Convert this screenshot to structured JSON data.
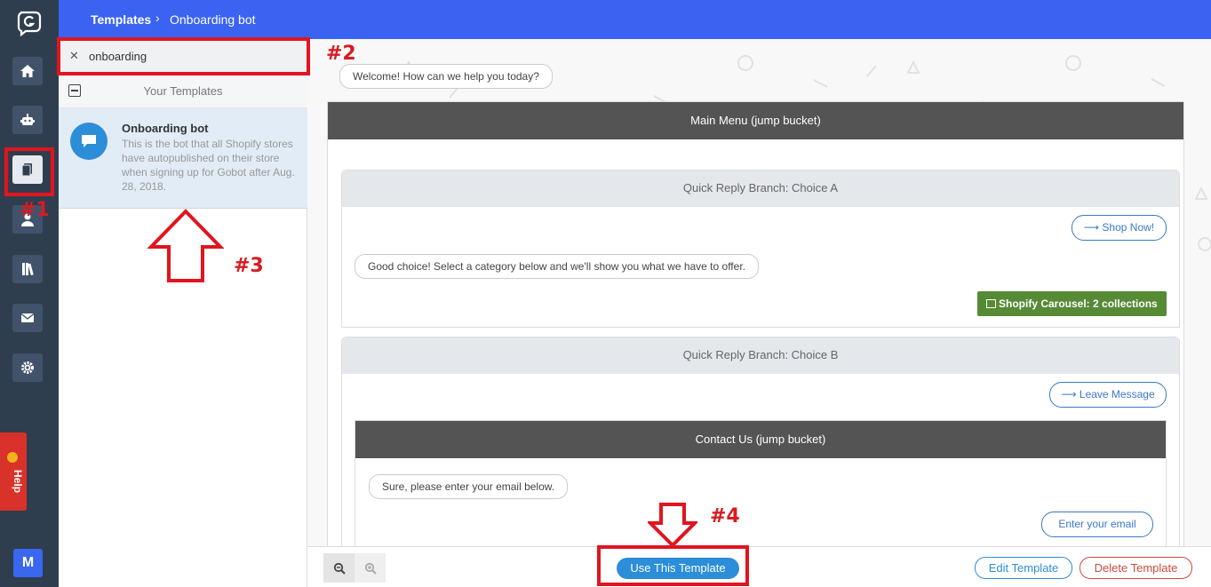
{
  "header": {
    "breadcrumb_root": "Templates",
    "breadcrumb_separator": "›",
    "breadcrumb_current": "Onboarding bot"
  },
  "rail": {
    "items": [
      "home-icon",
      "robot-icon",
      "templates-icon",
      "contacts-icon",
      "library-icon",
      "mail-icon",
      "settings-icon"
    ],
    "help_label": "Help",
    "avatar_initial": "M"
  },
  "search": {
    "value": "onboarding",
    "clear_symbol": "✕"
  },
  "templates": {
    "group_title": "Your Templates",
    "items": [
      {
        "title": "Onboarding bot",
        "description": "This is the bot that all Shopify stores have autopublished on their store when signing up for Gobot after Aug. 28, 2018."
      }
    ]
  },
  "flow": {
    "welcome_message": "Welcome! How can we help you today?",
    "main_bucket": "Main Menu (jump bucket)",
    "branch_a": {
      "title": "Quick Reply Branch: Choice A",
      "button": "⟶ Shop Now!",
      "message": "Good choice! Select a category below and we'll show you what we have to offer.",
      "carousel": "Shopify Carousel: 2 collections"
    },
    "branch_b": {
      "title": "Quick Reply Branch: Choice B",
      "button": "⟶ Leave Message",
      "sub_bucket": "Contact Us (jump bucket)",
      "message": "Sure, please enter your email below.",
      "input_button": "Enter your email"
    }
  },
  "footer": {
    "use_label": "Use This Template",
    "edit_label": "Edit Template",
    "delete_label": "Delete Template"
  },
  "annotations": {
    "label_1": "#1",
    "label_2": "#2",
    "label_3": "#3",
    "label_4": "#4"
  },
  "colors": {
    "rail_bg": "#2f3e4e",
    "header_bg": "#3b63f2",
    "accent": "#2c8dd8",
    "annotation": "#e0151f",
    "danger": "#d04a3c",
    "carousel": "#568a35"
  }
}
